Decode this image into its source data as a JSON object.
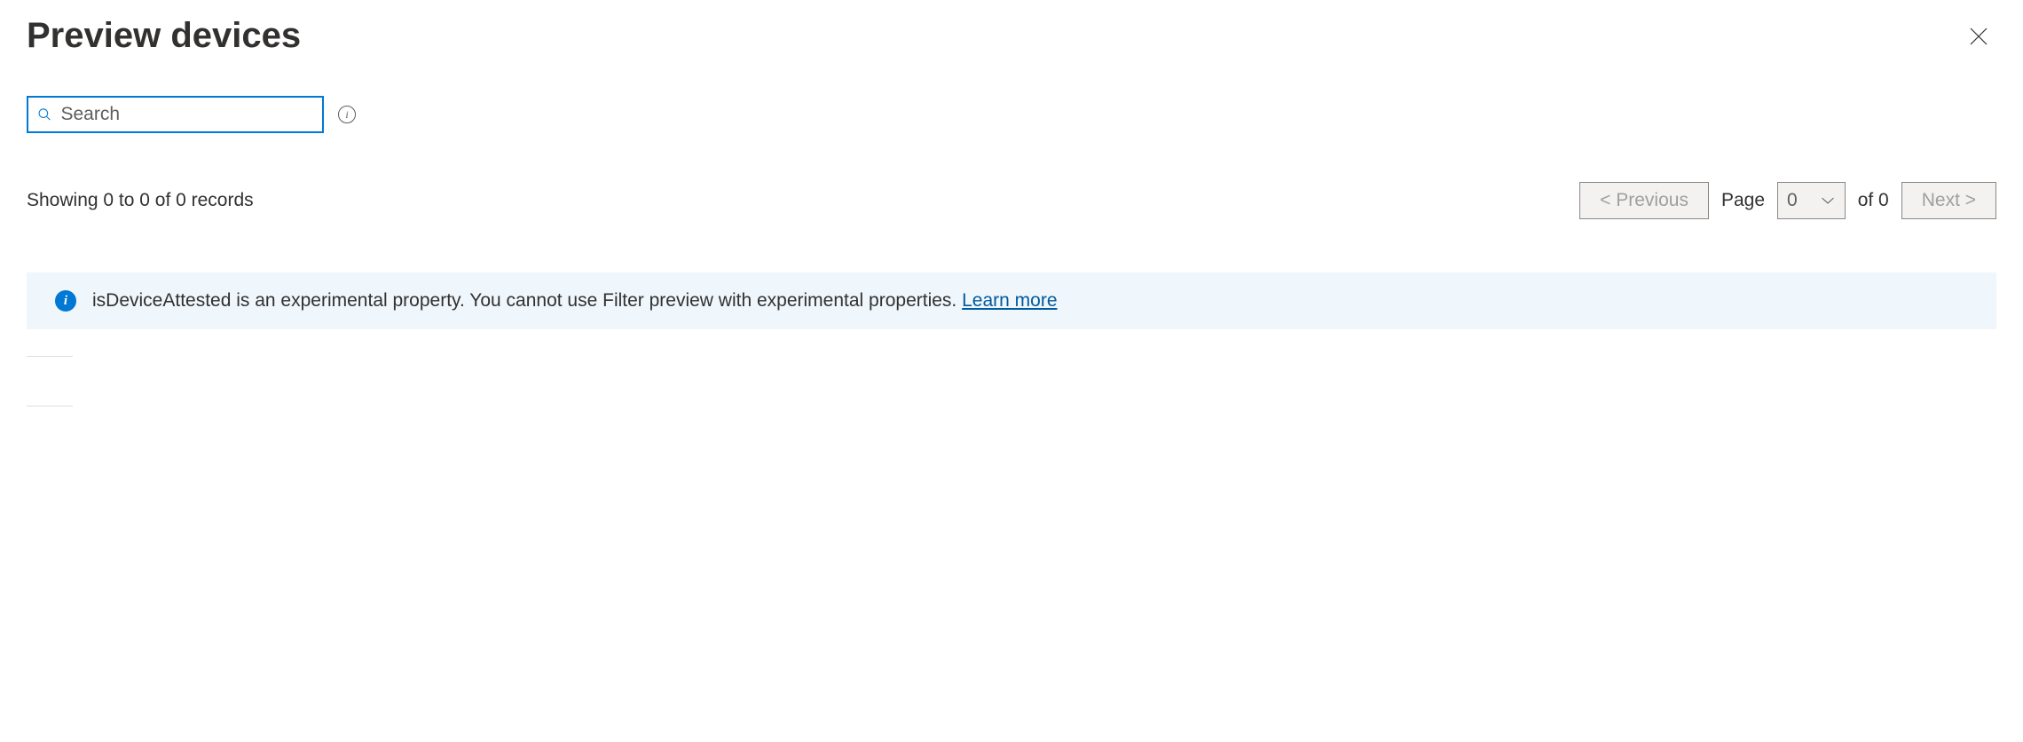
{
  "header": {
    "title": "Preview devices"
  },
  "search": {
    "placeholder": "Search"
  },
  "records": {
    "showing_text": "Showing 0 to 0 of 0 records"
  },
  "pagination": {
    "previous_label": "<  Previous",
    "page_label": "Page",
    "selected_page": "0",
    "of_label": "of 0",
    "next_label": "Next  >"
  },
  "banner": {
    "message": "isDeviceAttested is an experimental property. You cannot use Filter preview with experimental properties. ",
    "link_text": "Learn more"
  }
}
